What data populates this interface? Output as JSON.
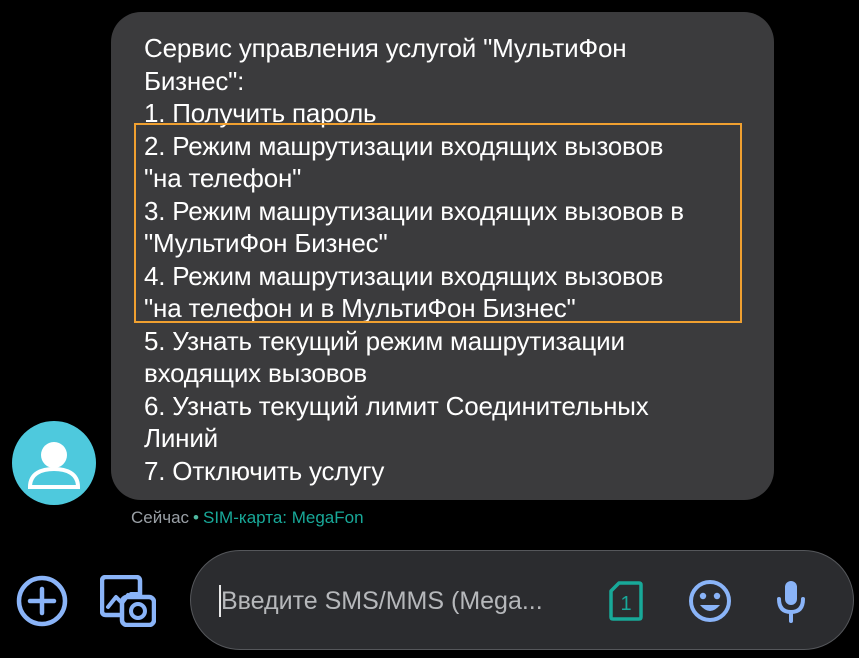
{
  "message": {
    "lines": [
      "Сервис управления услугой \"МультиФон",
      "Бизнес\":",
      "1. Получить пароль",
      "2. Режим машрутизации входящих вызовов",
      "\"на телефон\"",
      "3. Режим машрутизации входящих вызовов в",
      "\"МультиФон Бизнес\"",
      "4. Режим машрутизации входящих вызовов",
      "\"на телефон и в МультиФон Бизнес\"",
      "5. Узнать текущий режим машрутизации",
      "входящих вызовов",
      "6. Узнать текущий лимит Соединительных",
      "Линий",
      "7. Отключить услугу"
    ],
    "time": "Сейчас",
    "separator": "•",
    "sim_label": "SIM-карта: MegaFon"
  },
  "compose": {
    "placeholder": "Введите SMS/MMS (Mega...",
    "sim_number": "1"
  },
  "icons": {
    "avatar": "person-icon",
    "add": "plus-circle-icon",
    "gallery": "gallery-camera-icon",
    "sim": "sim-card-icon",
    "emoji": "emoji-icon",
    "mic": "microphone-icon"
  },
  "colors": {
    "background": "#000000",
    "bubble": "#3b3b3d",
    "avatar": "#4ec9dd",
    "highlight": "#f0a030",
    "accent_blue": "#8ab4f8",
    "sim_teal": "#18a999",
    "compose_bg": "#2b2c2f"
  }
}
